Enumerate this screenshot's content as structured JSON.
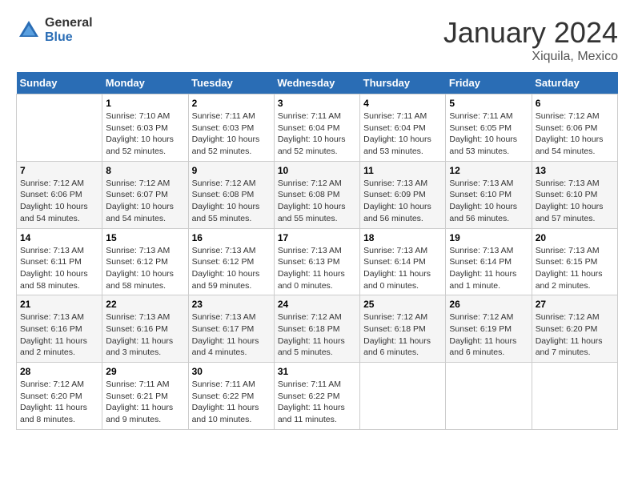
{
  "header": {
    "logo_line1": "General",
    "logo_line2": "Blue",
    "title": "January 2024",
    "subtitle": "Xiquila, Mexico"
  },
  "calendar": {
    "weekdays": [
      "Sunday",
      "Monday",
      "Tuesday",
      "Wednesday",
      "Thursday",
      "Friday",
      "Saturday"
    ],
    "weeks": [
      [
        {
          "day": "",
          "sunrise": "",
          "sunset": "",
          "daylight": ""
        },
        {
          "day": "1",
          "sunrise": "Sunrise: 7:10 AM",
          "sunset": "Sunset: 6:03 PM",
          "daylight": "Daylight: 10 hours and 52 minutes."
        },
        {
          "day": "2",
          "sunrise": "Sunrise: 7:11 AM",
          "sunset": "Sunset: 6:03 PM",
          "daylight": "Daylight: 10 hours and 52 minutes."
        },
        {
          "day": "3",
          "sunrise": "Sunrise: 7:11 AM",
          "sunset": "Sunset: 6:04 PM",
          "daylight": "Daylight: 10 hours and 52 minutes."
        },
        {
          "day": "4",
          "sunrise": "Sunrise: 7:11 AM",
          "sunset": "Sunset: 6:04 PM",
          "daylight": "Daylight: 10 hours and 53 minutes."
        },
        {
          "day": "5",
          "sunrise": "Sunrise: 7:11 AM",
          "sunset": "Sunset: 6:05 PM",
          "daylight": "Daylight: 10 hours and 53 minutes."
        },
        {
          "day": "6",
          "sunrise": "Sunrise: 7:12 AM",
          "sunset": "Sunset: 6:06 PM",
          "daylight": "Daylight: 10 hours and 54 minutes."
        }
      ],
      [
        {
          "day": "7",
          "sunrise": "Sunrise: 7:12 AM",
          "sunset": "Sunset: 6:06 PM",
          "daylight": "Daylight: 10 hours and 54 minutes."
        },
        {
          "day": "8",
          "sunrise": "Sunrise: 7:12 AM",
          "sunset": "Sunset: 6:07 PM",
          "daylight": "Daylight: 10 hours and 54 minutes."
        },
        {
          "day": "9",
          "sunrise": "Sunrise: 7:12 AM",
          "sunset": "Sunset: 6:08 PM",
          "daylight": "Daylight: 10 hours and 55 minutes."
        },
        {
          "day": "10",
          "sunrise": "Sunrise: 7:12 AM",
          "sunset": "Sunset: 6:08 PM",
          "daylight": "Daylight: 10 hours and 55 minutes."
        },
        {
          "day": "11",
          "sunrise": "Sunrise: 7:13 AM",
          "sunset": "Sunset: 6:09 PM",
          "daylight": "Daylight: 10 hours and 56 minutes."
        },
        {
          "day": "12",
          "sunrise": "Sunrise: 7:13 AM",
          "sunset": "Sunset: 6:10 PM",
          "daylight": "Daylight: 10 hours and 56 minutes."
        },
        {
          "day": "13",
          "sunrise": "Sunrise: 7:13 AM",
          "sunset": "Sunset: 6:10 PM",
          "daylight": "Daylight: 10 hours and 57 minutes."
        }
      ],
      [
        {
          "day": "14",
          "sunrise": "Sunrise: 7:13 AM",
          "sunset": "Sunset: 6:11 PM",
          "daylight": "Daylight: 10 hours and 58 minutes."
        },
        {
          "day": "15",
          "sunrise": "Sunrise: 7:13 AM",
          "sunset": "Sunset: 6:12 PM",
          "daylight": "Daylight: 10 hours and 58 minutes."
        },
        {
          "day": "16",
          "sunrise": "Sunrise: 7:13 AM",
          "sunset": "Sunset: 6:12 PM",
          "daylight": "Daylight: 10 hours and 59 minutes."
        },
        {
          "day": "17",
          "sunrise": "Sunrise: 7:13 AM",
          "sunset": "Sunset: 6:13 PM",
          "daylight": "Daylight: 11 hours and 0 minutes."
        },
        {
          "day": "18",
          "sunrise": "Sunrise: 7:13 AM",
          "sunset": "Sunset: 6:14 PM",
          "daylight": "Daylight: 11 hours and 0 minutes."
        },
        {
          "day": "19",
          "sunrise": "Sunrise: 7:13 AM",
          "sunset": "Sunset: 6:14 PM",
          "daylight": "Daylight: 11 hours and 1 minute."
        },
        {
          "day": "20",
          "sunrise": "Sunrise: 7:13 AM",
          "sunset": "Sunset: 6:15 PM",
          "daylight": "Daylight: 11 hours and 2 minutes."
        }
      ],
      [
        {
          "day": "21",
          "sunrise": "Sunrise: 7:13 AM",
          "sunset": "Sunset: 6:16 PM",
          "daylight": "Daylight: 11 hours and 2 minutes."
        },
        {
          "day": "22",
          "sunrise": "Sunrise: 7:13 AM",
          "sunset": "Sunset: 6:16 PM",
          "daylight": "Daylight: 11 hours and 3 minutes."
        },
        {
          "day": "23",
          "sunrise": "Sunrise: 7:13 AM",
          "sunset": "Sunset: 6:17 PM",
          "daylight": "Daylight: 11 hours and 4 minutes."
        },
        {
          "day": "24",
          "sunrise": "Sunrise: 7:12 AM",
          "sunset": "Sunset: 6:18 PM",
          "daylight": "Daylight: 11 hours and 5 minutes."
        },
        {
          "day": "25",
          "sunrise": "Sunrise: 7:12 AM",
          "sunset": "Sunset: 6:18 PM",
          "daylight": "Daylight: 11 hours and 6 minutes."
        },
        {
          "day": "26",
          "sunrise": "Sunrise: 7:12 AM",
          "sunset": "Sunset: 6:19 PM",
          "daylight": "Daylight: 11 hours and 6 minutes."
        },
        {
          "day": "27",
          "sunrise": "Sunrise: 7:12 AM",
          "sunset": "Sunset: 6:20 PM",
          "daylight": "Daylight: 11 hours and 7 minutes."
        }
      ],
      [
        {
          "day": "28",
          "sunrise": "Sunrise: 7:12 AM",
          "sunset": "Sunset: 6:20 PM",
          "daylight": "Daylight: 11 hours and 8 minutes."
        },
        {
          "day": "29",
          "sunrise": "Sunrise: 7:11 AM",
          "sunset": "Sunset: 6:21 PM",
          "daylight": "Daylight: 11 hours and 9 minutes."
        },
        {
          "day": "30",
          "sunrise": "Sunrise: 7:11 AM",
          "sunset": "Sunset: 6:22 PM",
          "daylight": "Daylight: 11 hours and 10 minutes."
        },
        {
          "day": "31",
          "sunrise": "Sunrise: 7:11 AM",
          "sunset": "Sunset: 6:22 PM",
          "daylight": "Daylight: 11 hours and 11 minutes."
        },
        {
          "day": "",
          "sunrise": "",
          "sunset": "",
          "daylight": ""
        },
        {
          "day": "",
          "sunrise": "",
          "sunset": "",
          "daylight": ""
        },
        {
          "day": "",
          "sunrise": "",
          "sunset": "",
          "daylight": ""
        }
      ]
    ]
  }
}
